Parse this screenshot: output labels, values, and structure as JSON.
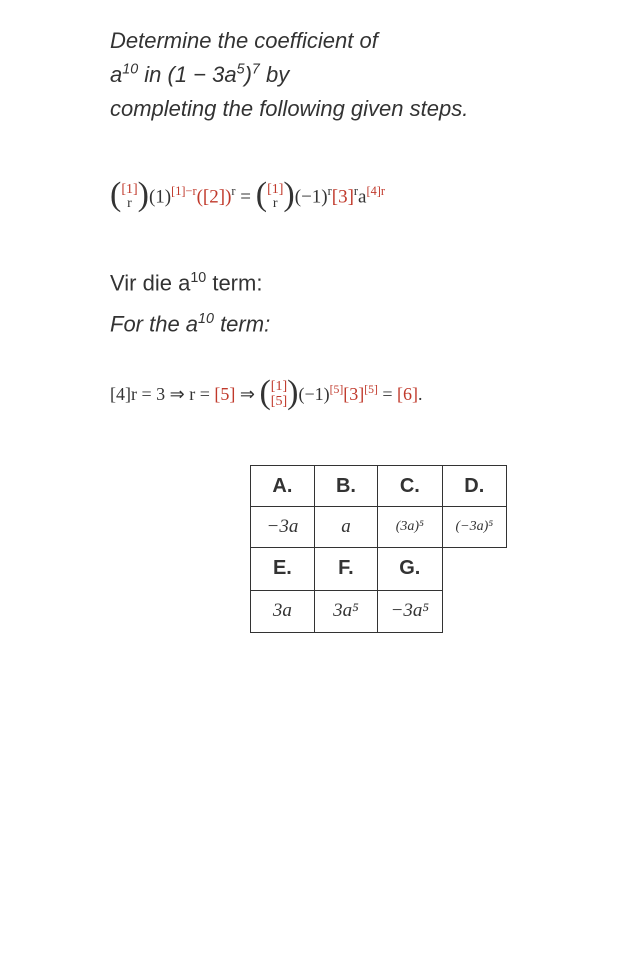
{
  "question": {
    "line1_pre": "Determine the coefficient of",
    "line2_a": "a",
    "line2_exp": "10",
    "line2_in": " in (1 − 3a",
    "line2_exp2": "5",
    "line2_close": ")",
    "line2_exp3": "7",
    "line2_by": " by",
    "line3": "completing the following given steps."
  },
  "formula": {
    "b1_top": "[1]",
    "b1_bot": "r",
    "t1": "(1)",
    "e1a": "[1]−r",
    "t2": "([2])",
    "e2": "r",
    "eq": " = ",
    "b2_top": "[1]",
    "b2_bot": "r",
    "t3": "(−1)",
    "e3": "r",
    "t4": "[3]",
    "e4": "r",
    "t5": "a",
    "e5": "[4]r"
  },
  "line_af": "Vir die a",
  "line_af_exp": "10",
  "line_af_post": " term:",
  "line_en": "For the a",
  "line_en_exp": "10",
  "line_en_post": " term:",
  "step": {
    "p1": "[4]r = 3 ⇒ r = ",
    "r5": "[5]",
    "arr": " ⇒ ",
    "b_top": "[1]",
    "b_bot": "[5]",
    "p2": "(−1)",
    "e2": "[5]",
    "p3": "[3]",
    "e3": "[5]",
    "eq": " = ",
    "r6": "[6]",
    "dot": "."
  },
  "table": {
    "h": [
      "A.",
      "B.",
      "C.",
      "D."
    ],
    "r1": [
      "−3a",
      "a",
      "(3a)⁵",
      "(−3a)⁵"
    ],
    "h2": [
      "E.",
      "F.",
      "G."
    ],
    "r2": [
      "3a",
      "3a⁵",
      "−3a⁵"
    ]
  }
}
